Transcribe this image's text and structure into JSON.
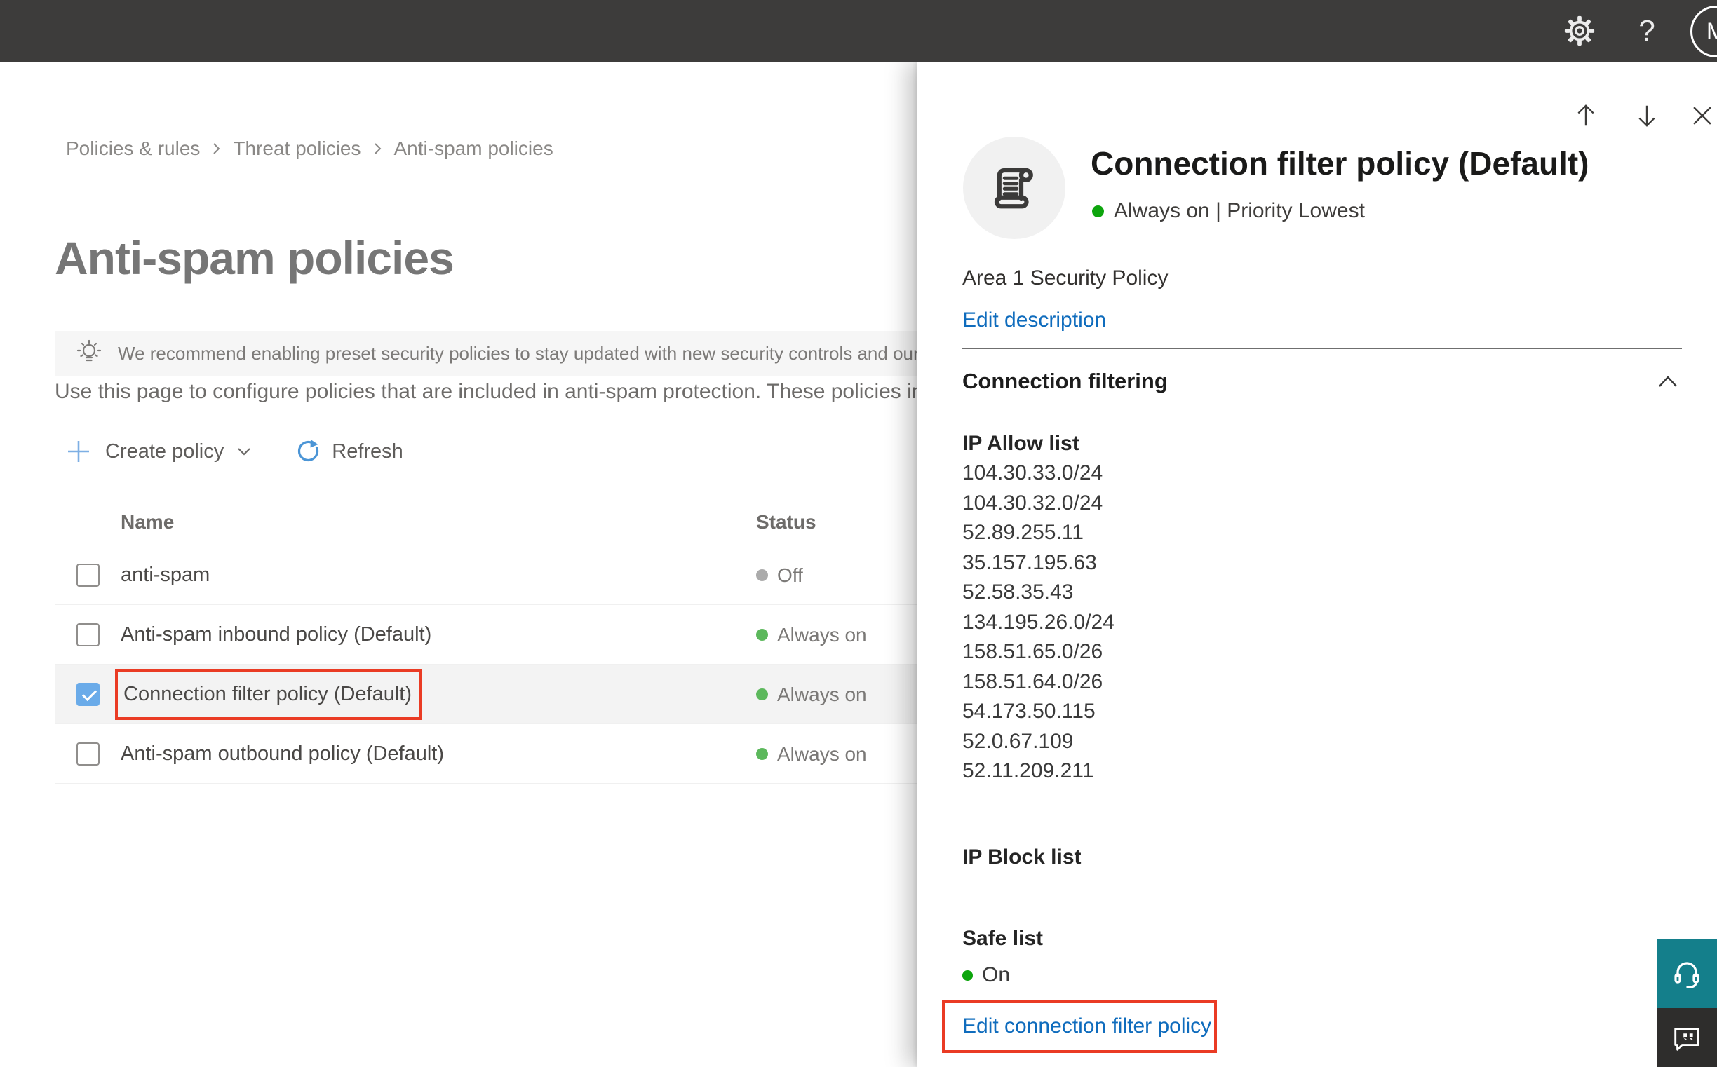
{
  "topbar": {
    "avatar_initial": "M",
    "help_glyph": "?"
  },
  "breadcrumb": {
    "items": [
      "Policies & rules",
      "Threat policies",
      "Anti-spam policies"
    ]
  },
  "page": {
    "title": "Anti-spam policies",
    "banner_text": "We recommend enabling preset security policies to stay updated with new security controls and our recomme",
    "intro_text": "Use this page to configure policies that are included in anti-spam protection. These policies include",
    "toolbar": {
      "create_policy_label": "Create policy",
      "refresh_label": "Refresh"
    }
  },
  "table": {
    "columns": {
      "name": "Name",
      "status": "Status"
    },
    "rows": [
      {
        "name": "anti-spam",
        "status": "Off"
      },
      {
        "name": "Anti-spam inbound policy (Default)",
        "status": "Always on"
      },
      {
        "name": "Connection filter policy (Default)",
        "status": "Always on"
      },
      {
        "name": "Anti-spam outbound policy (Default)",
        "status": "Always on"
      }
    ]
  },
  "flyout": {
    "title": "Connection filter policy (Default)",
    "status_line": "Always on | Priority Lowest",
    "description": "Area 1 Security Policy",
    "edit_description_label": "Edit description",
    "section_heading": "Connection filtering",
    "ip_allow_heading": "IP Allow list",
    "ip_allow": [
      "104.30.33.0/24",
      "104.30.32.0/24",
      "52.89.255.11",
      "35.157.195.63",
      "52.58.35.43",
      "134.195.26.0/24",
      "158.51.65.0/26",
      "158.51.64.0/26",
      "54.173.50.115",
      "52.0.67.109",
      "52.11.209.211"
    ],
    "ip_block_heading": "IP Block list",
    "safe_list_heading": "Safe list",
    "safe_list_status": "On",
    "edit_policy_label": "Edit connection filter policy"
  },
  "colors": {
    "topbar_gray": "#3d3c3b",
    "status_on_green_bright": "#0da50d",
    "status_on_green_table": "#5cb85c",
    "status_off_gray": "#ababab",
    "link_blue": "#0f6cbd",
    "selection_red": "#ea3b24",
    "checkbox_blue": "#6aabe9",
    "support_teal": "#147f8b"
  }
}
